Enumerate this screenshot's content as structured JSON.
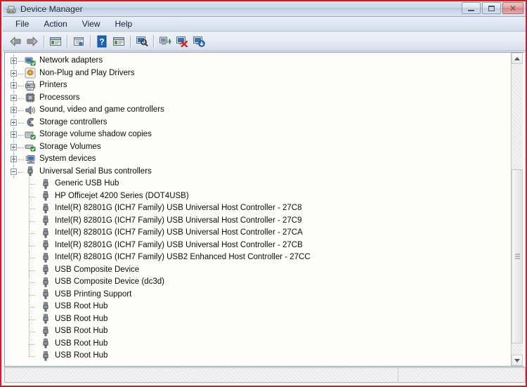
{
  "window": {
    "title": "Device Manager",
    "icon": "device-manager-icon",
    "accent_border": "#e81123",
    "titlebar_from": "#d8e2ee",
    "titlebar_to": "#dbe4f0",
    "controls": [
      {
        "name": "minimize-button",
        "glyph": "minimize"
      },
      {
        "name": "maximize-button",
        "glyph": "maximize"
      },
      {
        "name": "close-button",
        "glyph": "close",
        "label": "✕"
      }
    ]
  },
  "menu": {
    "items": [
      {
        "label": "File"
      },
      {
        "label": "Action"
      },
      {
        "label": "View"
      },
      {
        "label": "Help"
      }
    ]
  },
  "toolbar": {
    "buttons": [
      {
        "name": "back-button",
        "icon": "arrow-left-icon",
        "kind": "arrow-left"
      },
      {
        "name": "forward-button",
        "icon": "arrow-right-icon",
        "kind": "arrow-right"
      },
      {
        "name": "separator-1",
        "icon": "separator",
        "kind": "sep"
      },
      {
        "name": "show-hide-console-tree-button",
        "icon": "console-tree-icon",
        "kind": "window-green"
      },
      {
        "name": "separator-2",
        "icon": "separator",
        "kind": "sep"
      },
      {
        "name": "properties-button",
        "icon": "properties-icon",
        "kind": "properties"
      },
      {
        "name": "separator-3",
        "icon": "separator",
        "kind": "sep"
      },
      {
        "name": "help-button",
        "icon": "question-mark-icon",
        "kind": "help"
      },
      {
        "name": "view-button",
        "icon": "view-window-icon",
        "kind": "window-green"
      },
      {
        "name": "separator-4",
        "icon": "separator",
        "kind": "sep"
      },
      {
        "name": "scan-hardware-changes-button",
        "icon": "scan-magnifier-icon",
        "kind": "scan"
      },
      {
        "name": "separator-5",
        "icon": "separator",
        "kind": "sep"
      },
      {
        "name": "update-driver-button",
        "icon": "update-driver-icon",
        "kind": "update"
      },
      {
        "name": "uninstall-device-button",
        "icon": "uninstall-red-x-icon",
        "kind": "uninstall"
      },
      {
        "name": "disable-device-button",
        "icon": "disable-device-icon",
        "kind": "disable"
      }
    ]
  },
  "tree": {
    "rows": [
      {
        "label": "Network adapters",
        "level": 1,
        "state": "collapsed",
        "icon": "network-adapter-icon"
      },
      {
        "label": "Non-Plug and Play Drivers",
        "level": 1,
        "state": "collapsed",
        "icon": "gear-icon"
      },
      {
        "label": "Printers",
        "level": 1,
        "state": "collapsed",
        "icon": "printer-icon"
      },
      {
        "label": "Processors",
        "level": 1,
        "state": "collapsed",
        "icon": "processor-chip-icon"
      },
      {
        "label": "Sound, video and game controllers",
        "level": 1,
        "state": "collapsed",
        "icon": "speaker-icon"
      },
      {
        "label": "Storage controllers",
        "level": 1,
        "state": "collapsed",
        "icon": "storage-controller-icon"
      },
      {
        "label": "Storage volume shadow copies",
        "level": 1,
        "state": "collapsed",
        "icon": "shadow-copy-icon"
      },
      {
        "label": "Storage Volumes",
        "level": 1,
        "state": "collapsed",
        "icon": "storage-volume-icon"
      },
      {
        "label": "System devices",
        "level": 1,
        "state": "collapsed",
        "icon": "system-device-icon"
      },
      {
        "label": "Universal Serial Bus controllers",
        "level": 1,
        "state": "expanded",
        "icon": "usb-icon"
      },
      {
        "label": "Generic USB Hub",
        "level": 2,
        "state": "leaf",
        "icon": "usb-device-icon"
      },
      {
        "label": "HP Officejet 4200 Series (DOT4USB)",
        "level": 2,
        "state": "leaf",
        "icon": "usb-device-icon"
      },
      {
        "label": "Intel(R) 82801G (ICH7 Family) USB Universal Host Controller - 27C8",
        "level": 2,
        "state": "leaf",
        "icon": "usb-device-icon"
      },
      {
        "label": "Intel(R) 82801G (ICH7 Family) USB Universal Host Controller - 27C9",
        "level": 2,
        "state": "leaf",
        "icon": "usb-device-icon"
      },
      {
        "label": "Intel(R) 82801G (ICH7 Family) USB Universal Host Controller - 27CA",
        "level": 2,
        "state": "leaf",
        "icon": "usb-device-icon"
      },
      {
        "label": "Intel(R) 82801G (ICH7 Family) USB Universal Host Controller - 27CB",
        "level": 2,
        "state": "leaf",
        "icon": "usb-device-icon"
      },
      {
        "label": "Intel(R) 82801G (ICH7 Family) USB2 Enhanced Host Controller - 27CC",
        "level": 2,
        "state": "leaf",
        "icon": "usb-device-icon"
      },
      {
        "label": "USB Composite Device",
        "level": 2,
        "state": "leaf",
        "icon": "usb-device-icon"
      },
      {
        "label": "USB Composite Device (dc3d)",
        "level": 2,
        "state": "leaf",
        "icon": "usb-device-icon"
      },
      {
        "label": "USB Printing Support",
        "level": 2,
        "state": "leaf",
        "icon": "usb-device-icon"
      },
      {
        "label": "USB Root Hub",
        "level": 2,
        "state": "leaf",
        "icon": "usb-device-icon"
      },
      {
        "label": "USB Root Hub",
        "level": 2,
        "state": "leaf",
        "icon": "usb-device-icon"
      },
      {
        "label": "USB Root Hub",
        "level": 2,
        "state": "leaf",
        "icon": "usb-device-icon"
      },
      {
        "label": "USB Root Hub",
        "level": 2,
        "state": "leaf",
        "icon": "usb-device-icon"
      },
      {
        "label": "USB Root Hub",
        "level": 2,
        "state": "leaf",
        "icon": "usb-device-icon"
      }
    ]
  },
  "scrollbar": {
    "up_arrow": "scroll-up-arrow-icon",
    "down_arrow": "scroll-down-arrow-icon",
    "thumb": "scroll-thumb"
  },
  "status_bar": {
    "main_text": "",
    "side_text": ""
  }
}
